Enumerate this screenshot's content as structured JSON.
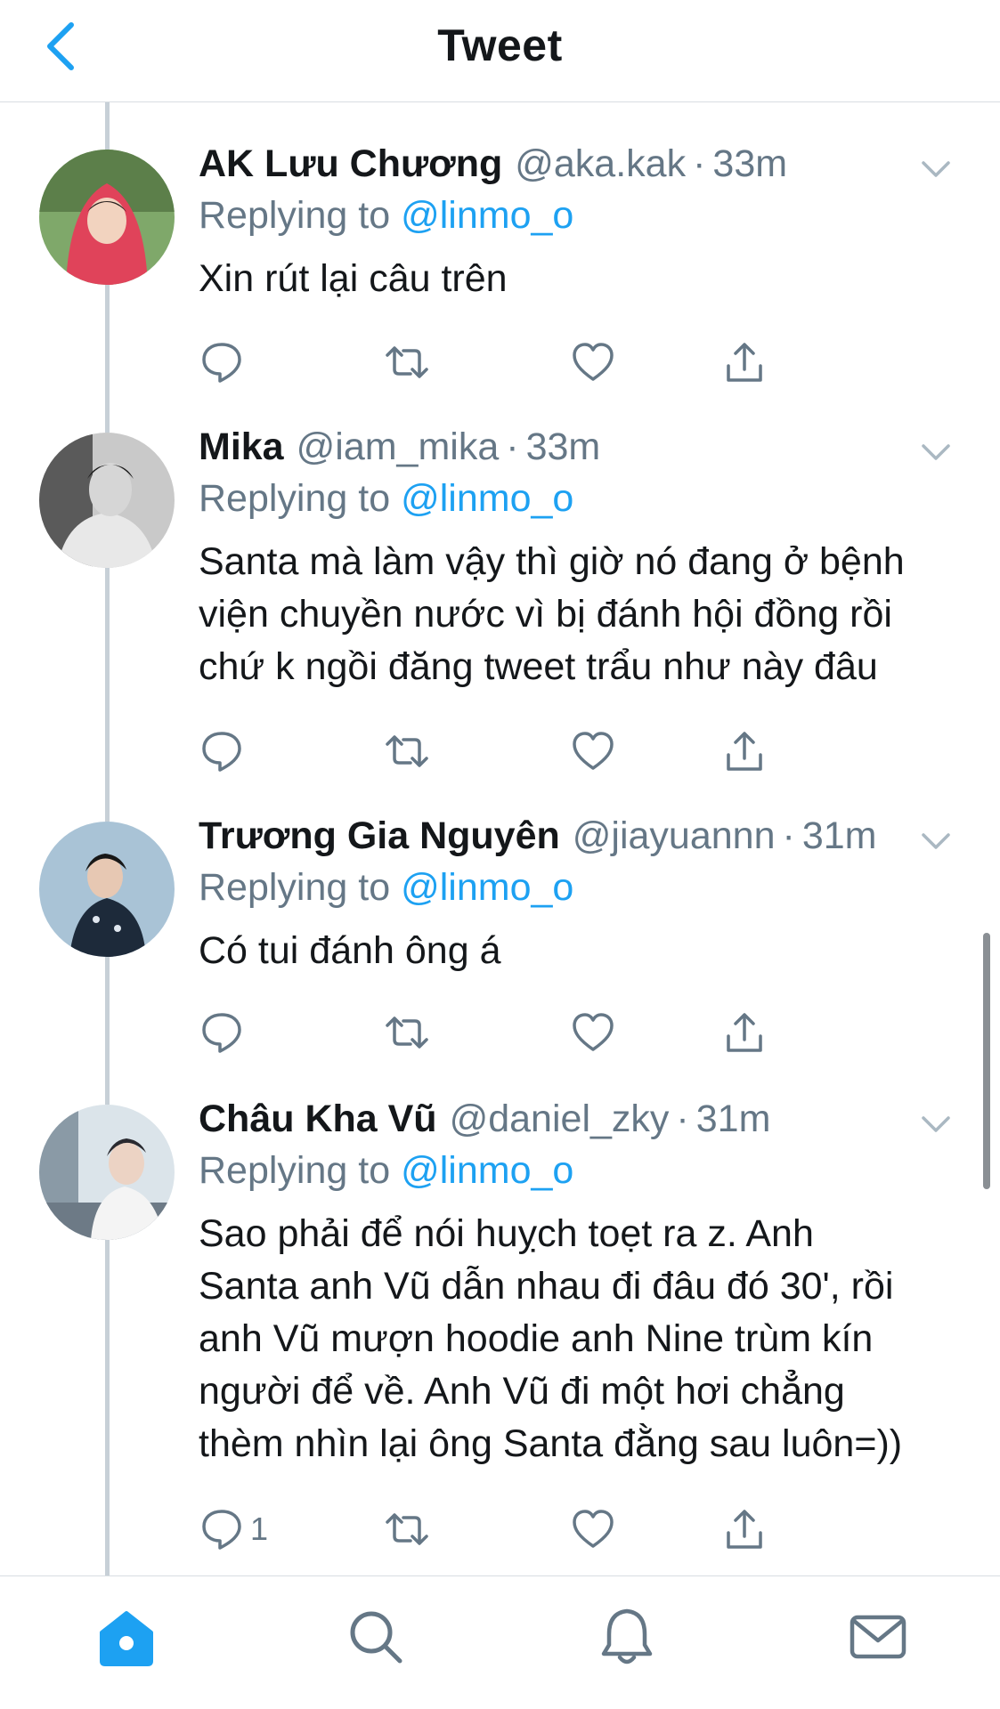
{
  "header": {
    "title": "Tweet",
    "back_icon": "chevron-left-icon"
  },
  "colors": {
    "accent": "#1da1f2",
    "muted": "#657786",
    "text": "#14171a",
    "thread_line": "#c7d0d7"
  },
  "tweets": [
    {
      "name": "AK Lưu Chương",
      "handle": "@aka.kak",
      "time": "33m",
      "replying_label": "Replying to",
      "replying_to": "@linmo_o",
      "text_lines": [
        "Xin rút lại câu trên"
      ],
      "reply_count": ""
    },
    {
      "name": "Mika",
      "handle": "@iam_mika",
      "time": "33m",
      "replying_label": "Replying to",
      "replying_to": "@linmo_o",
      "text_lines": [
        "Santa mà làm vậy thì giờ nó đang ở bệnh",
        "viện chuyền nước vì bị đánh hội đồng rồi",
        "chứ k ngồi đăng tweet trẩu như này đâu"
      ],
      "reply_count": ""
    },
    {
      "name": "Trương Gia Nguyên",
      "handle": "@jiayuannn",
      "time": "31m",
      "replying_label": "Replying to",
      "replying_to": "@linmo_o",
      "text_lines": [
        "Có tui đánh ông á"
      ],
      "reply_count": ""
    },
    {
      "name": "Châu Kha Vũ",
      "handle": "@daniel_zky",
      "time": "31m",
      "replying_label": "Replying to",
      "replying_to": "@linmo_o",
      "text_lines": [
        "Sao phải để nói huỵch toẹt ra z. Anh",
        "Santa anh Vũ dẫn nhau đi đâu đó 30', rồi",
        "anh Vũ mượn hoodie anh Nine trùm kín",
        "người để về. Anh Vũ đi một hơi chẳng",
        "thèm nhìn lại ông Santa đằng sau luôn=))"
      ],
      "reply_count": "1"
    }
  ],
  "tabbar": {
    "items": [
      "home-icon",
      "search-icon",
      "notifications-icon",
      "messages-icon"
    ],
    "active": "home-icon"
  }
}
